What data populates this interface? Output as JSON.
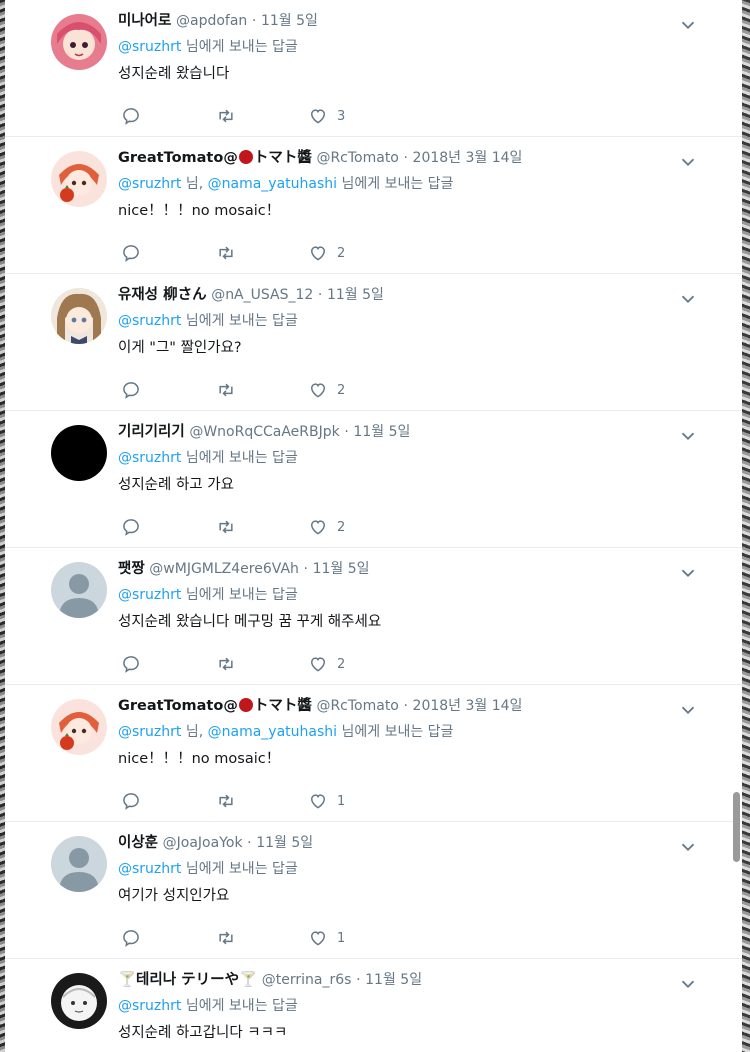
{
  "tweets": [
    {
      "name": "미나어로",
      "handle": "@apdofan",
      "time": "11월 5일",
      "reply_mention": "@sruzhrt",
      "reply_suffix": " 님에게 보내는 답글",
      "text": "성지순례 왔습니다",
      "likes": "3",
      "avatar": "pink-anime-avatar"
    },
    {
      "name": "GreatTomato@",
      "name_suffix": "トマト醬",
      "handle": "@RcTomato",
      "time": "2018년 3월 14일",
      "reply_mention": "@sruzhrt",
      "reply_mid": " 님, ",
      "reply_mention2": "@nama_yatuhashi",
      "reply_suffix": " 님에게 보내는 답글",
      "text": "nice！！！no mosaic！",
      "likes": "2",
      "avatar": "tomato-avatar"
    },
    {
      "name": "유재성 柳さん",
      "handle": "@nA_USAS_12",
      "time": "11월 5일",
      "reply_mention": "@sruzhrt",
      "reply_suffix": " 님에게 보내는 답글",
      "text": "이게 \"그\" 짤인가요?",
      "likes": "2",
      "avatar": "anime-girl-avatar"
    },
    {
      "name": "기리기리기",
      "handle": "@WnoRqCCaAeRBJpk",
      "time": "11월 5일",
      "reply_mention": "@sruzhrt",
      "reply_suffix": " 님에게 보내는 답글",
      "text": "성지순례 하고 가요",
      "likes": "2",
      "avatar": "black-avatar"
    },
    {
      "name": "팻짱",
      "handle": "@wMJGMLZ4ere6VAh",
      "time": "11월 5일",
      "reply_mention": "@sruzhrt",
      "reply_suffix": " 님에게 보내는 답글",
      "text": "성지순례 왔습니다 메구밍 꿈 꾸게 해주세요",
      "likes": "2",
      "avatar": "default-avatar"
    },
    {
      "name": "GreatTomato@",
      "name_suffix": "トマト醬",
      "handle": "@RcTomato",
      "time": "2018년 3월 14일",
      "reply_mention": "@sruzhrt",
      "reply_mid": " 님, ",
      "reply_mention2": "@nama_yatuhashi",
      "reply_suffix": " 님에게 보내는 답글",
      "text": "nice！！！no mosaic！",
      "likes": "1",
      "avatar": "tomato-avatar"
    },
    {
      "name": "이상훈",
      "handle": "@JoaJoaYok",
      "time": "11월 5일",
      "reply_mention": "@sruzhrt",
      "reply_suffix": " 님에게 보내는 답글",
      "text": "여기가 성지인가요",
      "likes": "1",
      "avatar": "default-avatar"
    },
    {
      "name": "🍸테리나 テリーや🍸",
      "handle": "@terrina_r6s",
      "time": "11월 5일",
      "reply_mention": "@sruzhrt",
      "reply_suffix": " 님에게 보내는 답글",
      "text": "성지순례 하고갑니다 ㅋㅋㅋ",
      "likes": "",
      "avatar": "sketch-avatar"
    }
  ],
  "separator": "·",
  "colors": {
    "link": "#1da1f2",
    "muted": "#657786",
    "text": "#14171a",
    "divider": "#e6ecf0"
  }
}
